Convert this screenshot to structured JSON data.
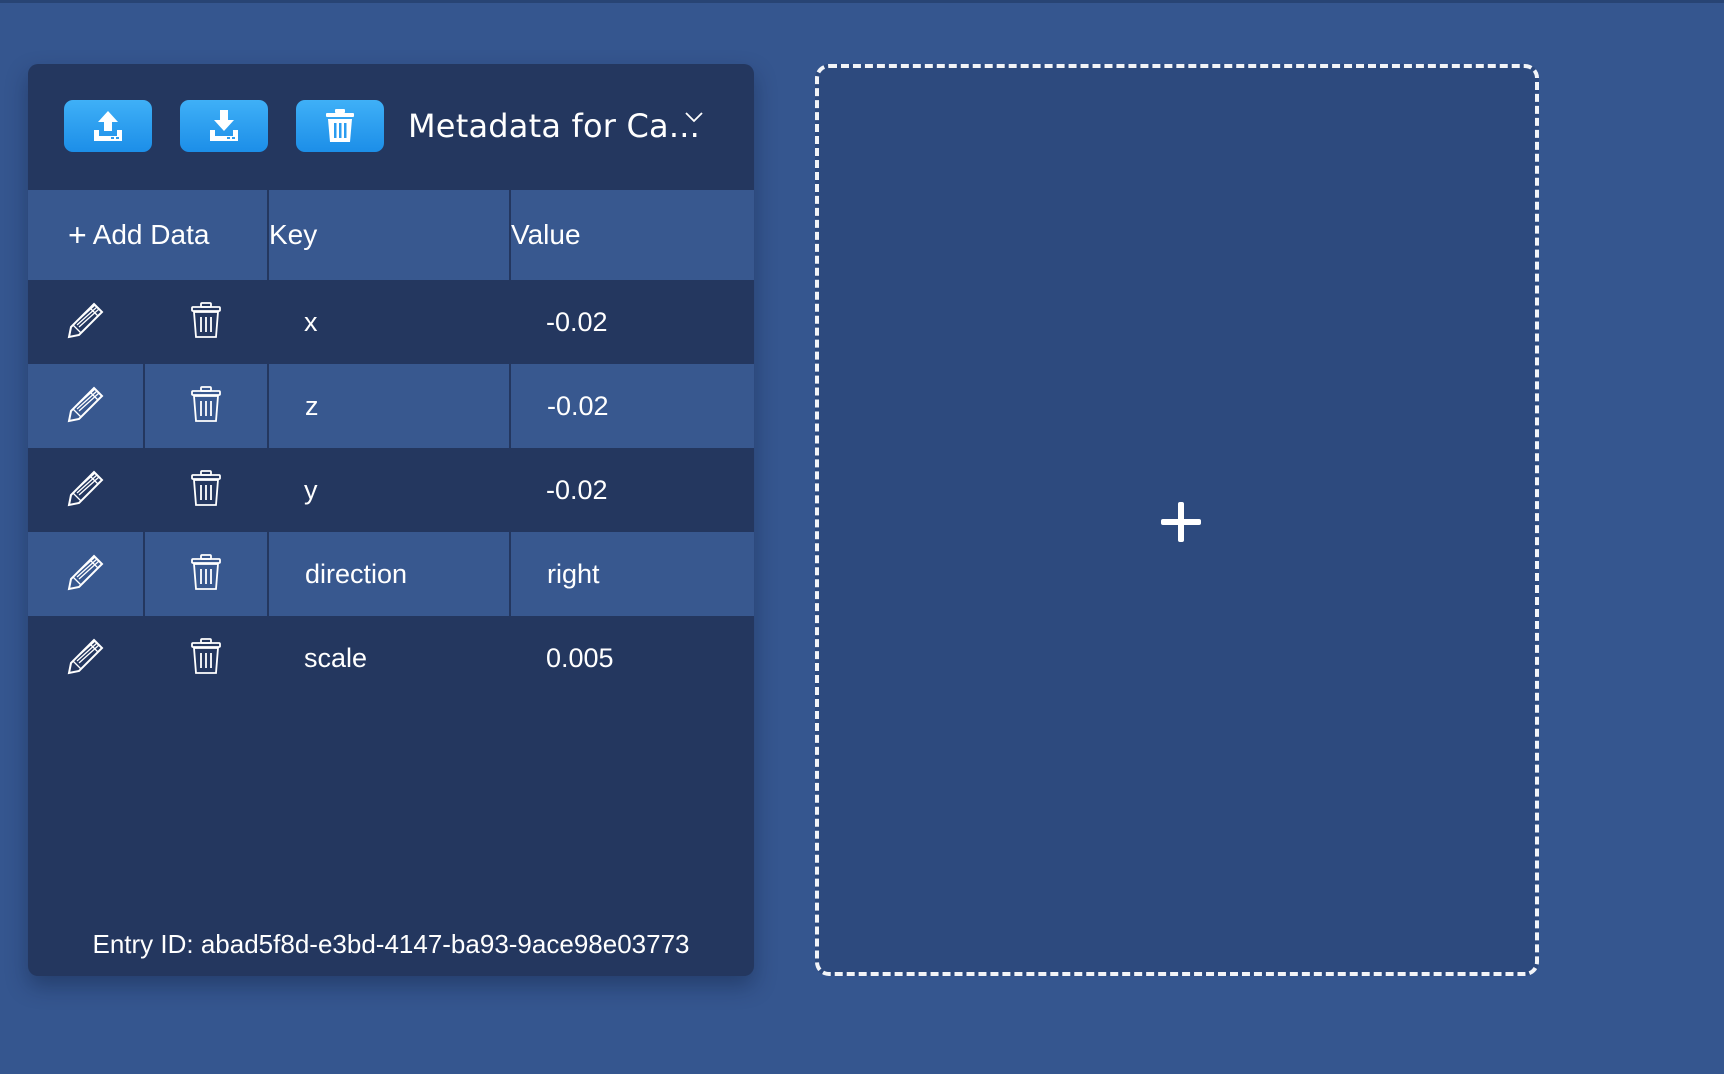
{
  "toolbar": {
    "upload_icon": "upload-icon",
    "download_icon": "download-icon",
    "delete_icon": "trash-icon",
    "select_label": "Metadata for Ca...",
    "select_icon": "chevron-down-icon"
  },
  "table": {
    "add_label": "Add Data",
    "columns": [
      "Key",
      "Value"
    ],
    "rows": [
      {
        "key": "x",
        "value": "-0.02"
      },
      {
        "key": "z",
        "value": "-0.02"
      },
      {
        "key": "y",
        "value": "-0.02"
      },
      {
        "key": "direction",
        "value": "right"
      },
      {
        "key": "scale",
        "value": "0.005"
      }
    ]
  },
  "footer": {
    "entry_id": "Entry ID: abad5f8d-e3bd-4147-ba93-9ace98e03773"
  },
  "dropzone": {
    "icon": "plus-icon"
  },
  "colors": {
    "background": "#35568f",
    "panel": "#24375f",
    "row_alt": "#38588f",
    "button": "#2a9cf0",
    "dropzone": "#2d4a7e"
  }
}
